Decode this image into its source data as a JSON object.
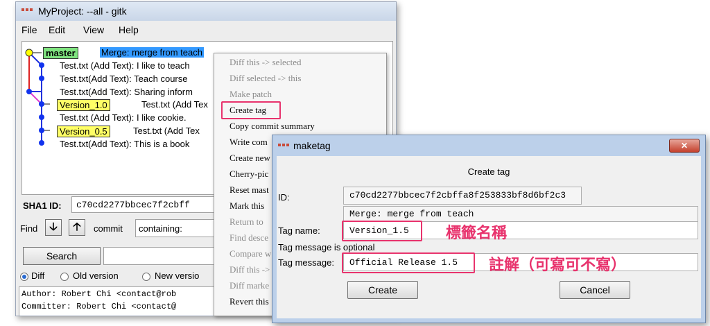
{
  "gitk": {
    "title": "MyProject: --all - gitk",
    "menu": [
      "File",
      "Edit",
      "View",
      "Help"
    ],
    "commits": [
      {
        "tag": "master",
        "text": "Merge: merge from teach"
      },
      {
        "tag": "",
        "text": "Test.txt (Add Text): I like to teach"
      },
      {
        "tag": "",
        "text": "Test.txt(Add Text): Teach course"
      },
      {
        "tag": "",
        "text": "Test.txt(Add Text): Sharing inform"
      },
      {
        "tag": "Version_1.0",
        "text": "Test.txt (Add Tex"
      },
      {
        "tag": "",
        "text": "Test.txt (Add Text): I like cookie."
      },
      {
        "tag": "Version_0.5",
        "text": "Test.txt (Add Tex"
      },
      {
        "tag": "",
        "text": "Test.txt(Add Text): This is a book"
      }
    ],
    "sha_label": "SHA1 ID:",
    "sha_value": "c70cd2277bbcec7f2cbff",
    "find_label": "Find",
    "down_arrow": "🡣",
    "up_arrow": "🡡",
    "commit_label": "commit",
    "containing_value": "containing:",
    "search_label": "Search",
    "radios": [
      {
        "label": "Diff",
        "selected": true
      },
      {
        "label": "Old version",
        "selected": false
      },
      {
        "label": "New versio",
        "selected": false
      }
    ],
    "diff_lines": [
      "Author: Robert Chi <contact@rob",
      "Committer: Robert Chi <contact@"
    ]
  },
  "context_menu": {
    "items": [
      {
        "label": "Diff this -> selected",
        "enabled": false
      },
      {
        "label": "Diff selected -> this",
        "enabled": false
      },
      {
        "label": "Make patch",
        "enabled": false
      },
      {
        "label": "Create tag",
        "enabled": true
      },
      {
        "label": "Copy commit summary",
        "enabled": true
      },
      {
        "label": "Write com",
        "enabled": true
      },
      {
        "label": "Create new",
        "enabled": true
      },
      {
        "label": "Cherry-pic",
        "enabled": true
      },
      {
        "label": "Reset mast",
        "enabled": true
      },
      {
        "label": "Mark this",
        "enabled": true
      },
      {
        "label": "Return to",
        "enabled": false
      },
      {
        "label": "Find desce",
        "enabled": false
      },
      {
        "label": "Compare w",
        "enabled": false
      },
      {
        "label": "Diff this ->",
        "enabled": false
      },
      {
        "label": "Diff marke",
        "enabled": false
      },
      {
        "label": "Revert this",
        "enabled": true
      }
    ]
  },
  "dialog": {
    "title": "maketag",
    "close_glyph": "✕",
    "heading": "Create tag",
    "id_label": "ID:",
    "id_value": "c70cd2277bbcec7f2cbffa8f253833bf8d6bf2c3",
    "message_value": "Merge: merge from teach",
    "tag_name_label": "Tag name:",
    "tag_name_value": "Version_1.5",
    "optional_note": "Tag message is optional",
    "tag_message_label": "Tag message:",
    "tag_message_value": "Official Release 1.5",
    "create_label": "Create",
    "cancel_label": "Cancel"
  },
  "annotations": {
    "tag_name": "標籤名稱",
    "tag_message": "註解（可寫可不寫）"
  },
  "colors": {
    "highlight": "#e8336d",
    "master_tag": "#7fe37f",
    "version_tag": "#ffff66",
    "selection": "#3399ff"
  }
}
